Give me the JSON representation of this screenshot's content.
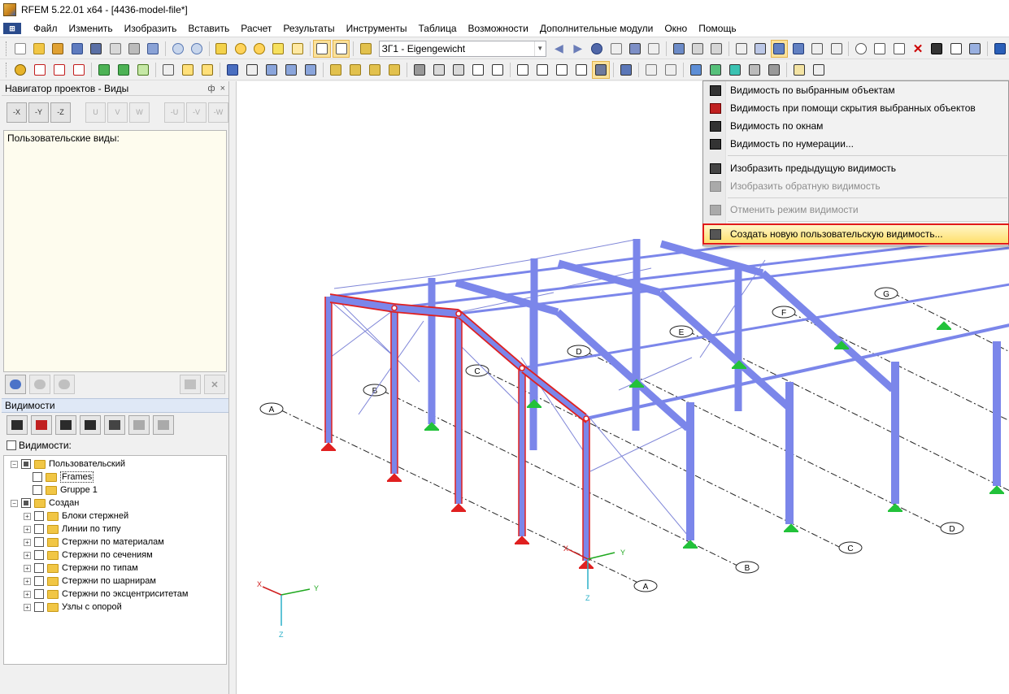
{
  "window": {
    "title": "RFEM 5.22.01 x64 - [4436-model-file*]"
  },
  "menu": {
    "items": [
      "Файл",
      "Изменить",
      "Изобразить",
      "Вставить",
      "Расчет",
      "Результаты",
      "Инструменты",
      "Таблица",
      "Возможности",
      "Дополнительные модули",
      "Окно",
      "Помощь"
    ]
  },
  "toolbar": {
    "load_case": "ЗГ1 - Eigengewicht"
  },
  "navigator": {
    "title": "Навигатор проектов - Виды",
    "header_buttons": [
      "ф",
      "×"
    ],
    "view_tool_labels": [
      "-X",
      "-Y",
      "-Z",
      "U",
      "V",
      "W",
      "-U",
      "-V",
      "-W"
    ],
    "user_views_label": "Пользовательские виды:"
  },
  "visibility": {
    "header": "Видимости",
    "checkbox_label": "Видимости:",
    "tree": [
      {
        "label": "Пользовательский",
        "level": 0,
        "expander": "−",
        "checkbox": "mixed",
        "boxed": false
      },
      {
        "label": "Frames",
        "level": 1,
        "expander": "",
        "checkbox": "empty",
        "boxed": true
      },
      {
        "label": "Gruppe 1",
        "level": 1,
        "expander": "",
        "checkbox": "empty",
        "boxed": false
      },
      {
        "label": "Создан",
        "level": 0,
        "expander": "−",
        "checkbox": "mixed",
        "boxed": false
      },
      {
        "label": "Блоки стержней",
        "level": 1,
        "expander": "+",
        "checkbox": "empty",
        "boxed": false
      },
      {
        "label": "Линии по типу",
        "level": 1,
        "expander": "+",
        "checkbox": "empty",
        "boxed": false
      },
      {
        "label": "Стержни по материалам",
        "level": 1,
        "expander": "+",
        "checkbox": "empty",
        "boxed": false
      },
      {
        "label": "Стержни по сечениям",
        "level": 1,
        "expander": "+",
        "checkbox": "empty",
        "boxed": false
      },
      {
        "label": "Стержни по типам",
        "level": 1,
        "expander": "+",
        "checkbox": "empty",
        "boxed": false
      },
      {
        "label": "Стержни по шарнирам",
        "level": 1,
        "expander": "+",
        "checkbox": "empty",
        "boxed": false
      },
      {
        "label": "Стержни по эксцентриситетам",
        "level": 1,
        "expander": "+",
        "checkbox": "empty",
        "boxed": false
      },
      {
        "label": "Узлы с опорой",
        "level": 1,
        "expander": "+",
        "checkbox": "empty",
        "boxed": false
      }
    ]
  },
  "dropdown": {
    "items": [
      {
        "label": "Видимость по выбранным объектам",
        "disabled": false,
        "icon": "visibility-selected-icon"
      },
      {
        "label": "Видимость при помощи скрытия выбранных объектов",
        "disabled": false,
        "icon": "visibility-hide-selected-icon"
      },
      {
        "label": "Видимость по окнам",
        "disabled": false,
        "icon": "visibility-window-icon"
      },
      {
        "label": "Видимость по нумерации...",
        "disabled": false,
        "icon": "visibility-numbering-icon"
      },
      {
        "label": "Изобразить предыдущую видимость",
        "disabled": false,
        "icon": "previous-visibility-icon"
      },
      {
        "label": "Изобразить обратную видимость",
        "disabled": true,
        "icon": "inverse-visibility-icon"
      },
      {
        "label": "Отменить режим видимости",
        "disabled": true,
        "icon": "cancel-visibility-icon"
      },
      {
        "label": "Создать новую пользовательскую видимость...",
        "disabled": false,
        "icon": "create-user-visibility-icon",
        "highlighted": true
      }
    ]
  },
  "model": {
    "axis_labels_grid": [
      "A",
      "B",
      "C",
      "D",
      "E",
      "F",
      "G"
    ],
    "global_axes": {
      "x": "X",
      "y": "Y",
      "z": "Z"
    },
    "member_color": "#7b86ea",
    "selected_color": "#e02020",
    "support_color": "#22c23a"
  }
}
